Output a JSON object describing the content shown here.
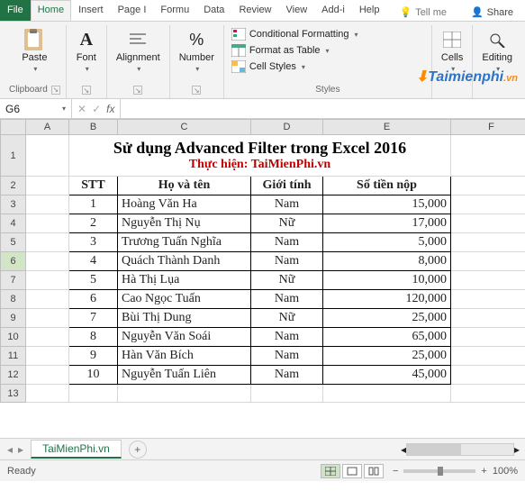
{
  "tabs": {
    "file": "File",
    "home": "Home",
    "insert": "Insert",
    "page": "Page I",
    "formulas": "Formu",
    "data": "Data",
    "review": "Review",
    "view": "View",
    "addins": "Add-i",
    "help": "Help",
    "tellme": "Tell me",
    "share": "Share"
  },
  "ribbon": {
    "clipboard": {
      "paste": "Paste",
      "label": "Clipboard"
    },
    "font": {
      "label": "Font"
    },
    "alignment": {
      "label": "Alignment"
    },
    "number": {
      "label": "Number"
    },
    "styles": {
      "conditional": "Conditional Formatting",
      "table": "Format as Table",
      "cell": "Cell Styles",
      "label": "Styles"
    },
    "cells": {
      "label": "Cells"
    },
    "editing": {
      "label": "Editing"
    }
  },
  "watermark": {
    "main": "Taimienphi",
    "suffix": ".vn"
  },
  "formula": {
    "namebox": "G6",
    "value": ""
  },
  "columns": [
    "A",
    "B",
    "C",
    "D",
    "E",
    "F"
  ],
  "title": {
    "main": "Sử dụng Advanced Filter trong Excel 2016",
    "sub": "Thực hiện: TaiMienPhi.vn"
  },
  "headers": {
    "stt": "STT",
    "name": "Họ và tên",
    "gender": "Giới tính",
    "amount": "Số tiền nộp"
  },
  "rows": [
    {
      "stt": "1",
      "name": "Hoàng Văn Ha",
      "gender": "Nam",
      "amount": "15,000"
    },
    {
      "stt": "2",
      "name": "Nguyễn Thị Nụ",
      "gender": "Nữ",
      "amount": "17,000"
    },
    {
      "stt": "3",
      "name": "Trương Tuấn Nghĩa",
      "gender": "Nam",
      "amount": "5,000"
    },
    {
      "stt": "4",
      "name": "Quách Thành Danh",
      "gender": "Nam",
      "amount": "8,000"
    },
    {
      "stt": "5",
      "name": "Hà Thị Lụa",
      "gender": "Nữ",
      "amount": "10,000"
    },
    {
      "stt": "6",
      "name": "Cao Ngọc Tuấn",
      "gender": "Nam",
      "amount": "120,000"
    },
    {
      "stt": "7",
      "name": "Bùi Thị Dung",
      "gender": "Nữ",
      "amount": "25,000"
    },
    {
      "stt": "8",
      "name": "Nguyễn Văn Soái",
      "gender": "Nam",
      "amount": "65,000"
    },
    {
      "stt": "9",
      "name": "Hàn Văn Bích",
      "gender": "Nam",
      "amount": "25,000"
    },
    {
      "stt": "10",
      "name": "Nguyễn Tuấn Liên",
      "gender": "Nam",
      "amount": "45,000"
    }
  ],
  "sheet": {
    "name": "TaiMienPhi.vn"
  },
  "status": {
    "ready": "Ready",
    "zoom": "100%"
  }
}
